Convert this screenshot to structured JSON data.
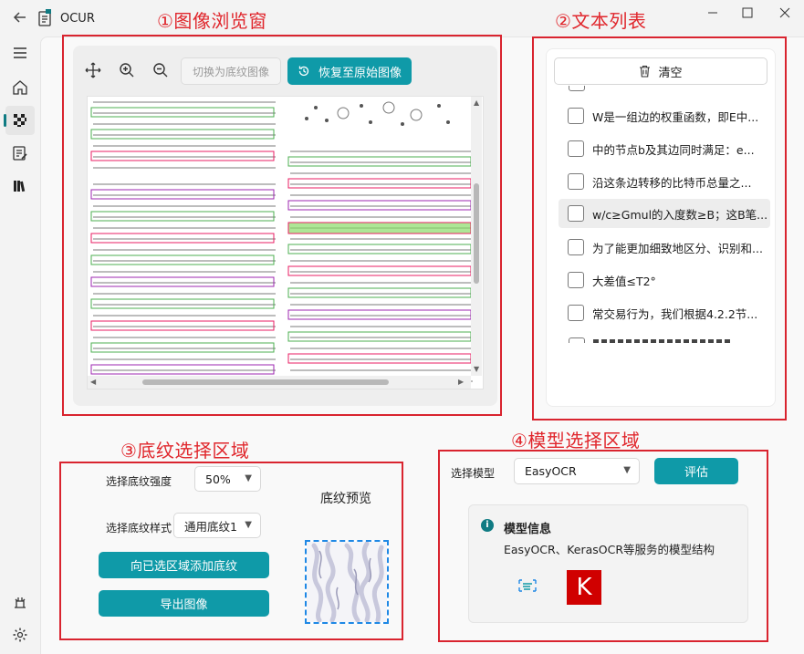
{
  "app": {
    "title": "OCUR"
  },
  "section_titles": {
    "viewer": "①图像浏览窗",
    "text_list": "②文本列表",
    "texture": "③底纹选择区域",
    "model": "④模型选择区域"
  },
  "viewer": {
    "switch_label": "切换为底纹图像",
    "restore_label": "恢复至原始图像"
  },
  "text_list": {
    "clear_label": "清空",
    "items": [
      {
        "text": "W是一组边的权重函数，即E中..."
      },
      {
        "text": "中的节点b及其边同时满足：e..."
      },
      {
        "text": "沿这条边转移的比特币总量之..."
      },
      {
        "text": "w/c≥Gmul的入度数≥B；这B笔...",
        "selected": true
      },
      {
        "text": "为了能更加细致地区分、识别和..."
      },
      {
        "text": "大差值≤T2°"
      },
      {
        "text": "常交易行为，我们根据4.2.2节..."
      }
    ]
  },
  "texture": {
    "strength_label": "选择底纹强度",
    "strength_value": "50%",
    "style_label": "选择底纹样式",
    "style_value": "通用底纹1",
    "add_label": "向已选区域添加底纹",
    "export_label": "导出图像",
    "preview_label": "底纹预览"
  },
  "model": {
    "select_label": "选择模型",
    "selected": "EasyOCR",
    "evaluate_label": "评估",
    "info_title": "模型信息",
    "info_text": "EasyOCR、KerasOCR等服务的模型结构",
    "keras_letter": "K"
  },
  "colors": {
    "accent": "#0f9aa8",
    "annotation_red": "#d9242f",
    "nav_indicator": "#0f7b83"
  }
}
